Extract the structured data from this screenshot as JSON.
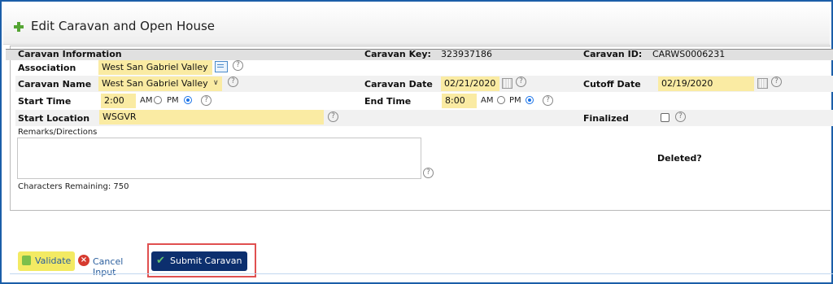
{
  "page": {
    "title": "Edit Caravan and Open House"
  },
  "section": {
    "heading": "Caravan Information",
    "caravan_key_label": "Caravan Key:",
    "caravan_key_value": "323937186",
    "caravan_id_label": "Caravan ID:",
    "caravan_id_value": "CARWS0006231"
  },
  "form": {
    "association_label": "Association",
    "association_value": "West San Gabriel Valley",
    "caravan_name_label": "Caravan Name",
    "caravan_name_value": "West San Gabriel Valley",
    "caravan_date_label": "Caravan Date",
    "caravan_date_value": "02/21/2020",
    "cutoff_date_label": "Cutoff Date",
    "cutoff_date_value": "02/19/2020",
    "start_time_label": "Start Time",
    "start_time_value": "2:00",
    "end_time_label": "End Time",
    "end_time_value": "8:00",
    "am_label": "AM",
    "pm_label": "PM",
    "start_location_label": "Start Location",
    "start_location_value": "WSGVR",
    "finalized_label": "Finalized",
    "remarks_label": "Remarks/Directions",
    "remarks_value": "",
    "chars_remaining": "Characters Remaining: 750",
    "deleted_label": "Deleted?",
    "help_glyph": "?"
  },
  "buttons": {
    "validate": "Validate",
    "cancel": "Cancel Input",
    "submit": "Submit Caravan"
  },
  "colors": {
    "field_bg": "#faeba3",
    "submit_bg": "#0c2f6e",
    "highlight_border": "#e05050",
    "accent_green": "#55a534"
  },
  "icons": [
    "plus-icon",
    "lookup-icon",
    "calendar-icon",
    "help-icon",
    "check-icon",
    "x-circle-icon"
  ]
}
